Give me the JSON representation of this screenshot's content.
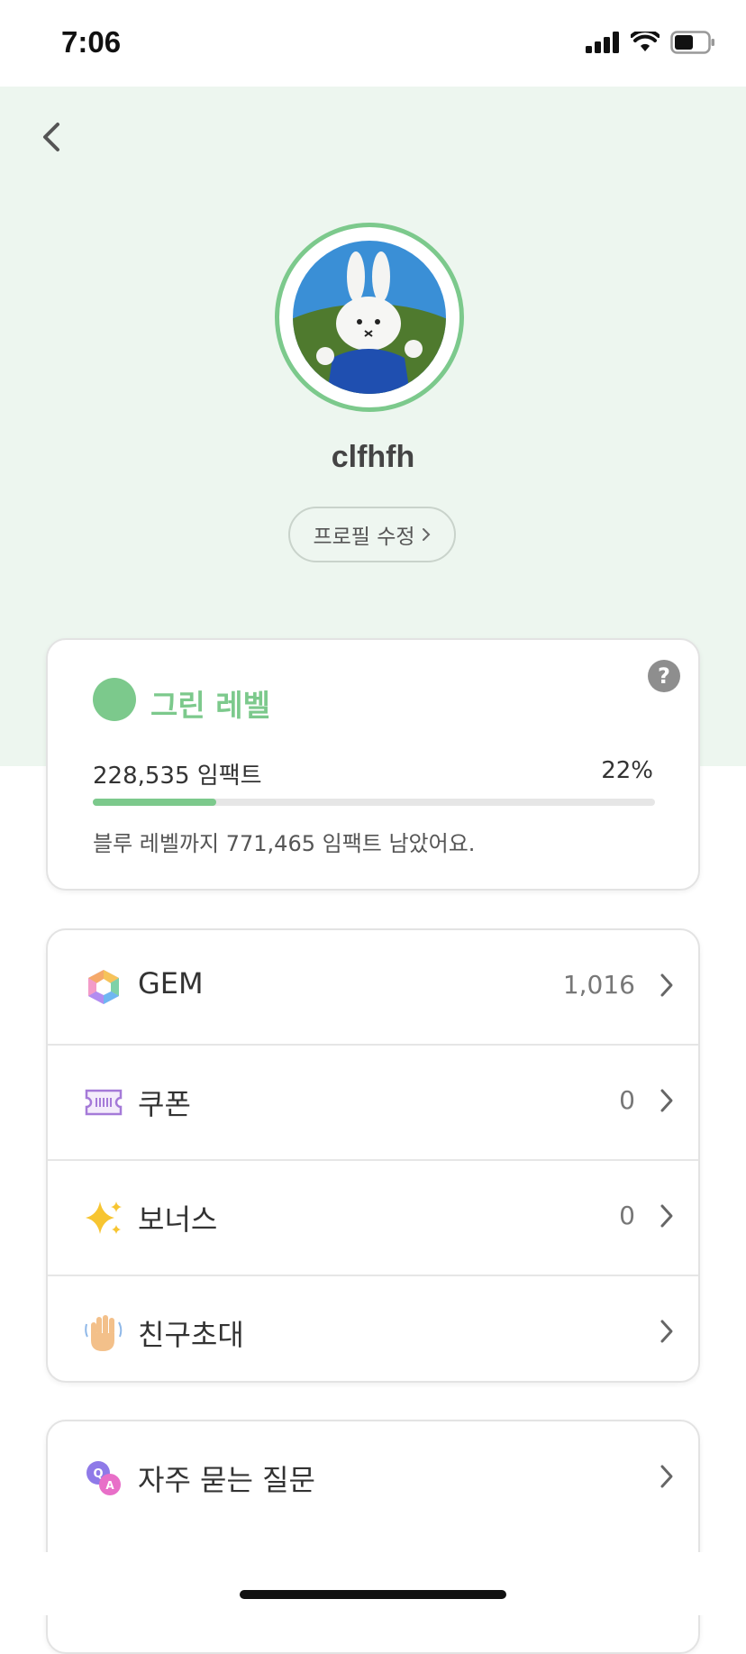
{
  "status_bar": {
    "time": "7:06"
  },
  "profile": {
    "username": "clfhfh",
    "edit_label": "프로필 수정"
  },
  "level": {
    "name": "그린 레벨",
    "impact": "228,535 임팩트",
    "percent_label": "22%",
    "progress": 0.22,
    "remaining": "블루 레벨까지 771,465 임팩트 남았어요.",
    "help": "?"
  },
  "menu": [
    {
      "label": "GEM",
      "value": "1,016",
      "icon": "gem-icon"
    },
    {
      "label": "쿠폰",
      "value": "0",
      "icon": "coupon-icon"
    },
    {
      "label": "보너스",
      "value": "0",
      "icon": "sparkles-icon"
    },
    {
      "label": "친구초대",
      "value": "",
      "icon": "waving-hand-icon"
    }
  ],
  "support": [
    {
      "label": "자주 묻는 질문",
      "icon": "qa-icon"
    }
  ],
  "colors": {
    "accent": "#7cc98c",
    "band": "#edf6ef"
  }
}
